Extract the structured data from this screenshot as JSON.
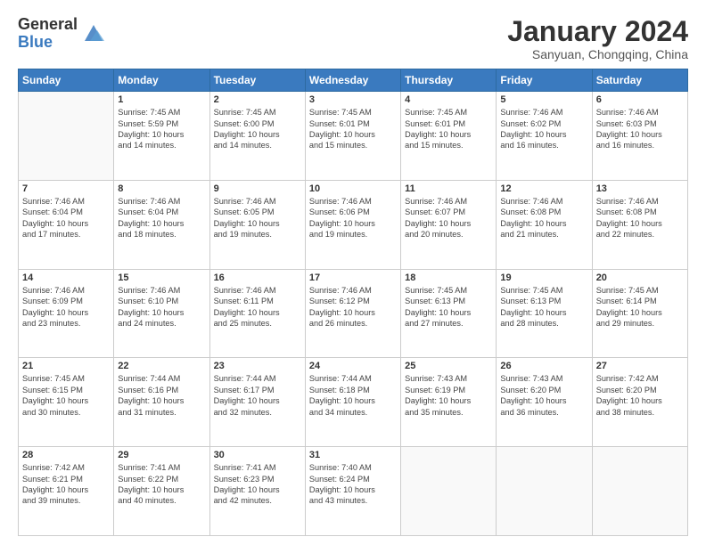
{
  "logo": {
    "general": "General",
    "blue": "Blue"
  },
  "header": {
    "month": "January 2024",
    "location": "Sanyuan, Chongqing, China"
  },
  "days_of_week": [
    "Sunday",
    "Monday",
    "Tuesday",
    "Wednesday",
    "Thursday",
    "Friday",
    "Saturday"
  ],
  "weeks": [
    [
      {
        "day": "",
        "info": ""
      },
      {
        "day": "1",
        "info": "Sunrise: 7:45 AM\nSunset: 5:59 PM\nDaylight: 10 hours\nand 14 minutes."
      },
      {
        "day": "2",
        "info": "Sunrise: 7:45 AM\nSunset: 6:00 PM\nDaylight: 10 hours\nand 14 minutes."
      },
      {
        "day": "3",
        "info": "Sunrise: 7:45 AM\nSunset: 6:01 PM\nDaylight: 10 hours\nand 15 minutes."
      },
      {
        "day": "4",
        "info": "Sunrise: 7:45 AM\nSunset: 6:01 PM\nDaylight: 10 hours\nand 15 minutes."
      },
      {
        "day": "5",
        "info": "Sunrise: 7:46 AM\nSunset: 6:02 PM\nDaylight: 10 hours\nand 16 minutes."
      },
      {
        "day": "6",
        "info": "Sunrise: 7:46 AM\nSunset: 6:03 PM\nDaylight: 10 hours\nand 16 minutes."
      }
    ],
    [
      {
        "day": "7",
        "info": "Sunrise: 7:46 AM\nSunset: 6:04 PM\nDaylight: 10 hours\nand 17 minutes."
      },
      {
        "day": "8",
        "info": "Sunrise: 7:46 AM\nSunset: 6:04 PM\nDaylight: 10 hours\nand 18 minutes."
      },
      {
        "day": "9",
        "info": "Sunrise: 7:46 AM\nSunset: 6:05 PM\nDaylight: 10 hours\nand 19 minutes."
      },
      {
        "day": "10",
        "info": "Sunrise: 7:46 AM\nSunset: 6:06 PM\nDaylight: 10 hours\nand 19 minutes."
      },
      {
        "day": "11",
        "info": "Sunrise: 7:46 AM\nSunset: 6:07 PM\nDaylight: 10 hours\nand 20 minutes."
      },
      {
        "day": "12",
        "info": "Sunrise: 7:46 AM\nSunset: 6:08 PM\nDaylight: 10 hours\nand 21 minutes."
      },
      {
        "day": "13",
        "info": "Sunrise: 7:46 AM\nSunset: 6:08 PM\nDaylight: 10 hours\nand 22 minutes."
      }
    ],
    [
      {
        "day": "14",
        "info": "Sunrise: 7:46 AM\nSunset: 6:09 PM\nDaylight: 10 hours\nand 23 minutes."
      },
      {
        "day": "15",
        "info": "Sunrise: 7:46 AM\nSunset: 6:10 PM\nDaylight: 10 hours\nand 24 minutes."
      },
      {
        "day": "16",
        "info": "Sunrise: 7:46 AM\nSunset: 6:11 PM\nDaylight: 10 hours\nand 25 minutes."
      },
      {
        "day": "17",
        "info": "Sunrise: 7:46 AM\nSunset: 6:12 PM\nDaylight: 10 hours\nand 26 minutes."
      },
      {
        "day": "18",
        "info": "Sunrise: 7:45 AM\nSunset: 6:13 PM\nDaylight: 10 hours\nand 27 minutes."
      },
      {
        "day": "19",
        "info": "Sunrise: 7:45 AM\nSunset: 6:13 PM\nDaylight: 10 hours\nand 28 minutes."
      },
      {
        "day": "20",
        "info": "Sunrise: 7:45 AM\nSunset: 6:14 PM\nDaylight: 10 hours\nand 29 minutes."
      }
    ],
    [
      {
        "day": "21",
        "info": "Sunrise: 7:45 AM\nSunset: 6:15 PM\nDaylight: 10 hours\nand 30 minutes."
      },
      {
        "day": "22",
        "info": "Sunrise: 7:44 AM\nSunset: 6:16 PM\nDaylight: 10 hours\nand 31 minutes."
      },
      {
        "day": "23",
        "info": "Sunrise: 7:44 AM\nSunset: 6:17 PM\nDaylight: 10 hours\nand 32 minutes."
      },
      {
        "day": "24",
        "info": "Sunrise: 7:44 AM\nSunset: 6:18 PM\nDaylight: 10 hours\nand 34 minutes."
      },
      {
        "day": "25",
        "info": "Sunrise: 7:43 AM\nSunset: 6:19 PM\nDaylight: 10 hours\nand 35 minutes."
      },
      {
        "day": "26",
        "info": "Sunrise: 7:43 AM\nSunset: 6:20 PM\nDaylight: 10 hours\nand 36 minutes."
      },
      {
        "day": "27",
        "info": "Sunrise: 7:42 AM\nSunset: 6:20 PM\nDaylight: 10 hours\nand 38 minutes."
      }
    ],
    [
      {
        "day": "28",
        "info": "Sunrise: 7:42 AM\nSunset: 6:21 PM\nDaylight: 10 hours\nand 39 minutes."
      },
      {
        "day": "29",
        "info": "Sunrise: 7:41 AM\nSunset: 6:22 PM\nDaylight: 10 hours\nand 40 minutes."
      },
      {
        "day": "30",
        "info": "Sunrise: 7:41 AM\nSunset: 6:23 PM\nDaylight: 10 hours\nand 42 minutes."
      },
      {
        "day": "31",
        "info": "Sunrise: 7:40 AM\nSunset: 6:24 PM\nDaylight: 10 hours\nand 43 minutes."
      },
      {
        "day": "",
        "info": ""
      },
      {
        "day": "",
        "info": ""
      },
      {
        "day": "",
        "info": ""
      }
    ]
  ]
}
